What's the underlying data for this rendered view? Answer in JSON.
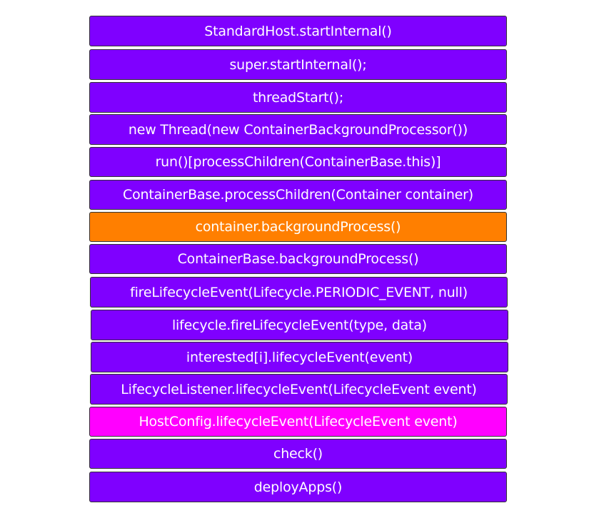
{
  "colors": {
    "default": "#7f00ff",
    "highlight_orange": "#ff7f00",
    "highlight_magenta": "#ff00ff",
    "text": "#ffffff"
  },
  "steps": [
    {
      "label": "StandardHost.startInternal()",
      "color": "#7f00ff"
    },
    {
      "label": "super.startInternal();",
      "color": "#7f00ff"
    },
    {
      "label": "threadStart();",
      "color": "#7f00ff"
    },
    {
      "label": "new Thread(new ContainerBackgroundProcessor())",
      "color": "#7f00ff"
    },
    {
      "label": "run()[processChildren(ContainerBase.this)]",
      "color": "#7f00ff"
    },
    {
      "label": "ContainerBase.processChildren(Container container)",
      "color": "#7f00ff"
    },
    {
      "label": "container.backgroundProcess()",
      "color": "#ff7f00"
    },
    {
      "label": "ContainerBase.backgroundProcess()",
      "color": "#7f00ff"
    },
    {
      "label": "fireLifecycleEvent(Lifecycle.PERIODIC_EVENT, null)",
      "color": "#7f00ff"
    },
    {
      "label": "lifecycle.fireLifecycleEvent(type, data)",
      "color": "#7f00ff"
    },
    {
      "label": "interested[i].lifecycleEvent(event)",
      "color": "#7f00ff"
    },
    {
      "label": "LifecycleListener.lifecycleEvent(LifecycleEvent event)",
      "color": "#7f00ff"
    },
    {
      "label": "HostConfig.lifecycleEvent(LifecycleEvent event)",
      "color": "#ff00ff"
    },
    {
      "label": "check()",
      "color": "#7f00ff"
    },
    {
      "label": "deployApps()",
      "color": "#7f00ff"
    }
  ]
}
